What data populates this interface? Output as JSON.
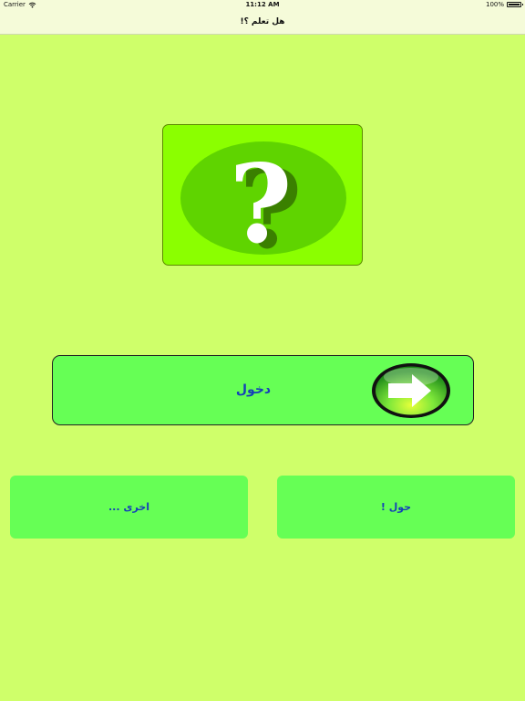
{
  "status_bar": {
    "carrier": "Carrier",
    "time": "11:12 AM",
    "battery": "100%",
    "wifi_icon": "wifi-icon",
    "battery_icon": "battery-icon"
  },
  "nav": {
    "title": "هل تعلم ؟!"
  },
  "logo": {
    "icon": "question-mark-icon"
  },
  "enter": {
    "label": "دخول",
    "icon": "arrow-right-icon"
  },
  "actions": {
    "other_label": "اخرى ...",
    "about_label": "حول !"
  },
  "colors": {
    "background": "#cfff6a",
    "bar": "#f5fbd9",
    "button": "#66ff55",
    "logo_bg": "#8bff00",
    "label_text": "#1540b8"
  }
}
